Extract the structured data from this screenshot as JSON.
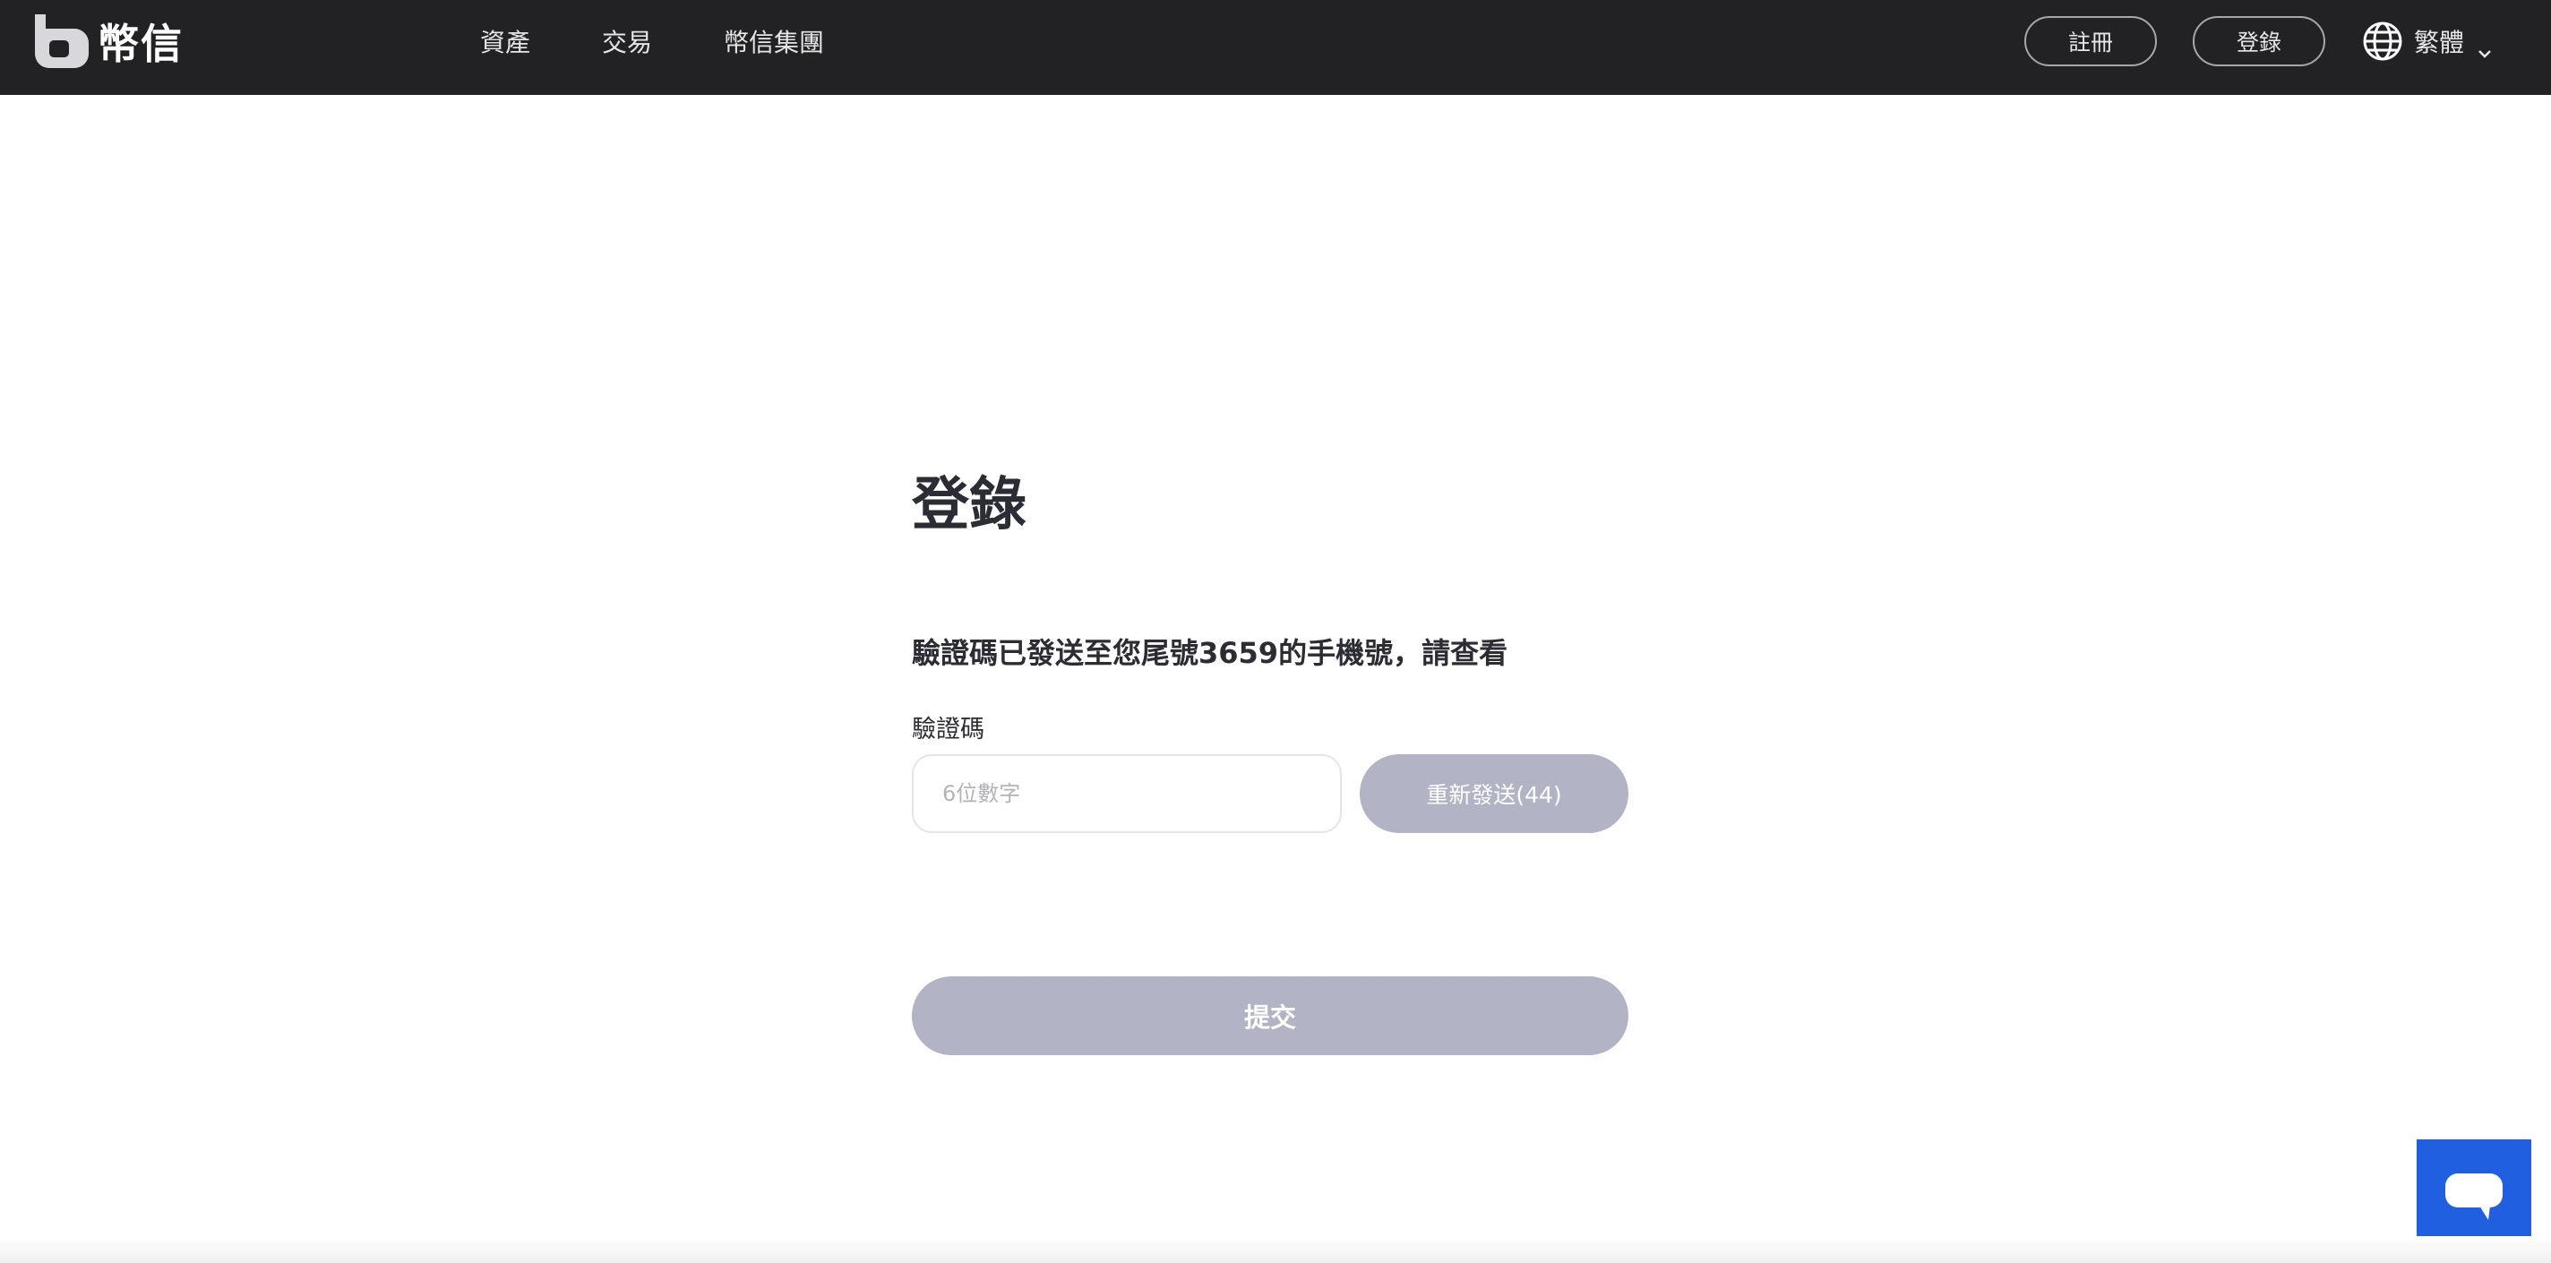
{
  "brand": {
    "name": "幣信",
    "logo_icon": "b-logo-icon"
  },
  "nav": {
    "items": [
      {
        "label": "資產"
      },
      {
        "label": "交易"
      },
      {
        "label": "幣信集團"
      }
    ]
  },
  "header": {
    "register_label": "註冊",
    "login_label": "登錄",
    "language_label": "繁體",
    "language_icon": "globe-icon",
    "dropdown_icon": "chevron-down-icon"
  },
  "login": {
    "title": "登錄",
    "notice": "驗證碼已發送至您尾號3659的手機號，請查看",
    "code_label": "驗證碼",
    "code_value": "",
    "code_placeholder": "6位數字",
    "resend_label": "重新發送(44)",
    "submit_label": "提交"
  },
  "chat": {
    "icon": "chat-bubble-icon"
  },
  "colors": {
    "topbar_bg": "#222224",
    "button_disabled": "#b3b3c6",
    "chat_accent": "#1f5fe0",
    "text_dark": "#2c2c35"
  }
}
